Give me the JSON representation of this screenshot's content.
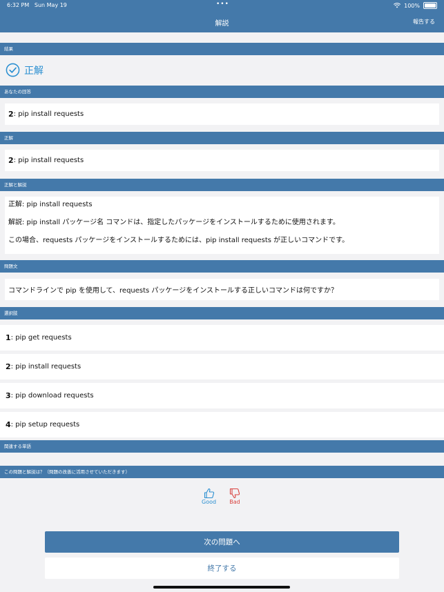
{
  "status": {
    "time": "6:32 PM",
    "date": "Sun May 19",
    "battery": "100%"
  },
  "nav": {
    "title": "解説",
    "report": "報告する"
  },
  "sections": {
    "result": "結果",
    "your_answer": "あなたの回答",
    "correct": "正解",
    "explanation": "正解と解説",
    "question": "問題文",
    "choices": "選択肢",
    "related": "関連する単語",
    "feedback": "この問題と解説は？（問題の改善に活用させていただきます）"
  },
  "result": {
    "label": "正解"
  },
  "your_answer": {
    "num": "2",
    "text": ": pip install requests"
  },
  "correct_answer": {
    "num": "2",
    "text": ": pip install requests"
  },
  "explanation": {
    "line1": "正解: pip install requests",
    "line2": "解説: pip install パッケージ名 コマンドは、指定したパッケージをインストールするために使用されます。",
    "line3": "この場合、requests パッケージをインストールするためには、pip install requests が正しいコマンドです。"
  },
  "question": {
    "text": "コマンドラインで pip を使用して、requests パッケージをインストールする正しいコマンドは何ですか？"
  },
  "choices": [
    {
      "num": "1",
      "text": ": pip get requests"
    },
    {
      "num": "2",
      "text": ": pip install requests"
    },
    {
      "num": "3",
      "text": ": pip download requests"
    },
    {
      "num": "4",
      "text": ": pip setup requests"
    }
  ],
  "feedback": {
    "good": "Good",
    "bad": "Bad"
  },
  "buttons": {
    "next": "次の問題へ",
    "finish": "終了する"
  },
  "colors": {
    "accent": "#4479aa",
    "good": "#2a8fd1",
    "bad": "#d9423e"
  }
}
